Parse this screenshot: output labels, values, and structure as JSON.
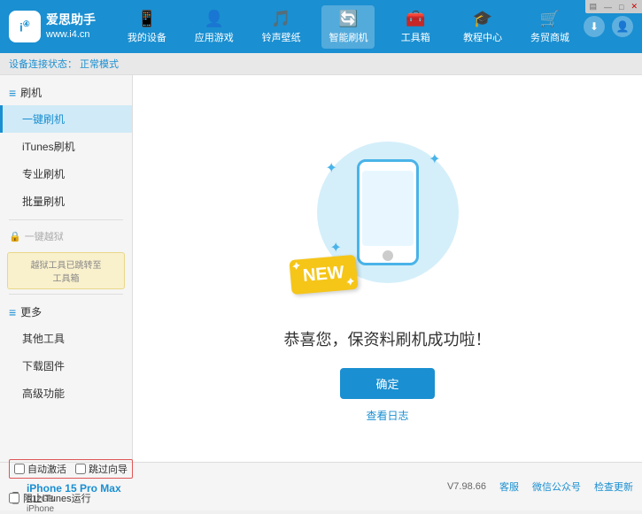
{
  "header": {
    "logo_title": "爱思助手",
    "logo_subtitle": "www.i4.cn",
    "logo_char": "i",
    "nav": [
      {
        "id": "my-device",
        "label": "我的设备",
        "icon": "📱"
      },
      {
        "id": "app-games",
        "label": "应用游戏",
        "icon": "👤"
      },
      {
        "id": "ringtone",
        "label": "铃声壁纸",
        "icon": "🎵"
      },
      {
        "id": "smart-flash",
        "label": "智能刷机",
        "icon": "🔄",
        "active": true
      },
      {
        "id": "toolbox",
        "label": "工具箱",
        "icon": "🧰"
      },
      {
        "id": "tutorial",
        "label": "教程中心",
        "icon": "🎓"
      },
      {
        "id": "service",
        "label": "务贸商城",
        "icon": "🛒"
      }
    ]
  },
  "breadcrumb": {
    "prefix": "设备连接状态：",
    "status": "正常模式"
  },
  "sidebar": {
    "section_flash": "刷机",
    "items_flash": [
      {
        "id": "one-click-flash",
        "label": "一键刷机",
        "active": true
      },
      {
        "id": "itunes-flash",
        "label": "iTunes刷机"
      },
      {
        "id": "pro-flash",
        "label": "专业刷机"
      },
      {
        "id": "batch-flash",
        "label": "批量刷机"
      }
    ],
    "section_oneclick": "一键越狱",
    "oneclick_notice_line1": "越狱工具已跳转至",
    "oneclick_notice_line2": "工具箱",
    "section_more": "更多",
    "items_more": [
      {
        "id": "other-tools",
        "label": "其他工具"
      },
      {
        "id": "download-firmware",
        "label": "下载固件"
      },
      {
        "id": "advanced",
        "label": "高级功能"
      }
    ]
  },
  "main": {
    "success_text": "恭喜您，保资料刷机成功啦！",
    "confirm_button": "确定",
    "log_link": "查看日志"
  },
  "status_bar": {
    "auto_activate_label": "自动激活",
    "guide_label": "跳过向导",
    "device_name": "iPhone 15 Pro Max",
    "device_storage": "512GB",
    "device_type": "iPhone",
    "stop_itunes_label": "阻止iTunes运行",
    "version": "V7.98.66",
    "home_label": "客服",
    "wechat_label": "微信公众号",
    "check_update_label": "检查更新"
  },
  "window_controls": {
    "minimize": "—",
    "maximize": "□",
    "close": "✕"
  },
  "icons": {
    "logo": "i4",
    "phone": "📱",
    "download": "⬇",
    "user": "👤"
  }
}
